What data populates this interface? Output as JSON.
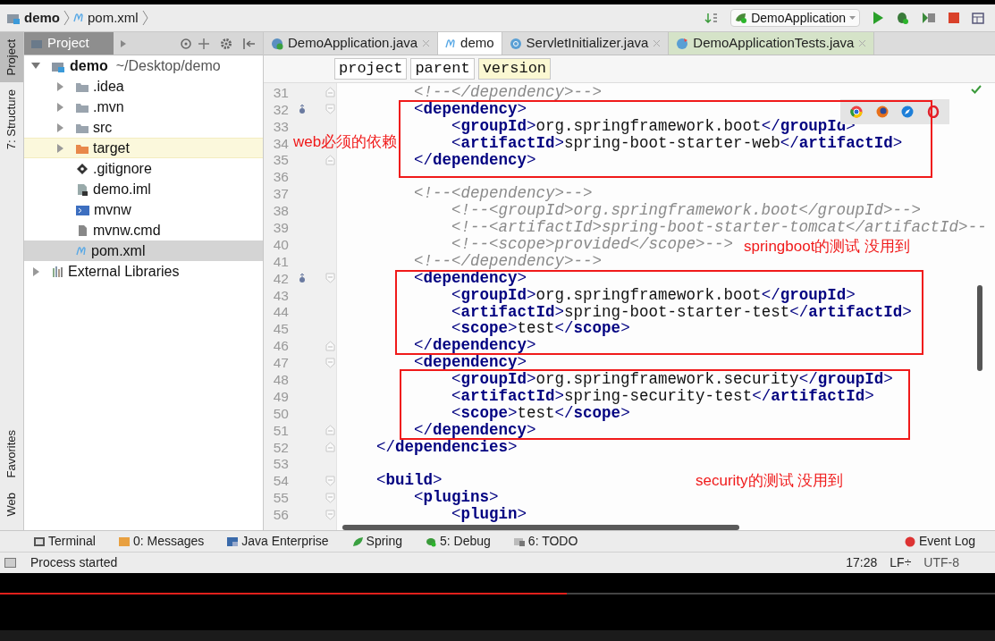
{
  "navigation_bar": {
    "breadcrumbs": [
      {
        "label": "demo",
        "kind": "module"
      },
      {
        "label": "pom.xml",
        "kind": "maven"
      }
    ],
    "run_configuration": "DemoApplication"
  },
  "tool_strip": {
    "left_top": [
      {
        "label": "Project",
        "selected": true
      },
      {
        "label": "7: Structure",
        "selected": false
      }
    ],
    "left_bottom": [
      {
        "label": "Favorites",
        "selected": false
      },
      {
        "label": "Web",
        "selected": false
      }
    ]
  },
  "project_panel": {
    "title": "Project",
    "tree": [
      {
        "label": "demo",
        "path": "~/Desktop/demo",
        "kind": "module",
        "expanded": true,
        "selected": false,
        "highlighted": false,
        "children": [
          {
            "label": ".idea",
            "kind": "folder",
            "expanded": false,
            "selected": false,
            "highlighted": false
          },
          {
            "label": ".mvn",
            "kind": "folder",
            "expanded": false,
            "selected": false,
            "highlighted": false
          },
          {
            "label": "src",
            "kind": "folder",
            "expanded": false,
            "selected": false,
            "highlighted": false
          },
          {
            "label": "target",
            "kind": "excluded-folder",
            "expanded": false,
            "selected": false,
            "highlighted": true
          },
          {
            "label": ".gitignore",
            "kind": "git",
            "selected": false,
            "highlighted": false
          },
          {
            "label": "demo.iml",
            "kind": "iml",
            "selected": false,
            "highlighted": false
          },
          {
            "label": "mvnw",
            "kind": "script",
            "selected": false,
            "highlighted": false
          },
          {
            "label": "mvnw.cmd",
            "kind": "file",
            "selected": false,
            "highlighted": false
          },
          {
            "label": "pom.xml",
            "kind": "maven",
            "selected": true,
            "highlighted": false
          }
        ]
      },
      {
        "label": "External Libraries",
        "kind": "library",
        "expanded": false,
        "selected": false,
        "highlighted": false
      }
    ]
  },
  "editor": {
    "tabs": [
      {
        "label": "DemoApplication.java",
        "kind": "spring",
        "selected": false
      },
      {
        "label": "demo",
        "kind": "maven",
        "selected": true
      },
      {
        "label": "ServletInitializer.java",
        "kind": "class",
        "selected": false
      },
      {
        "label": "DemoApplicationTests.java",
        "kind": "test",
        "selected": false
      }
    ],
    "tag_path": [
      {
        "label": "project",
        "selected": false
      },
      {
        "label": "parent",
        "selected": false
      },
      {
        "label": "version",
        "selected": true
      }
    ],
    "lines": [
      {
        "number": "31",
        "kind": "comment",
        "text": "        <!--</dependency>-->",
        "fold_close": true
      },
      {
        "number": "32",
        "kind": "code",
        "text": "        <dependency>",
        "fold_open": true,
        "overridden": true
      },
      {
        "number": "33",
        "kind": "code",
        "text": "            <groupId>org.springframework.boot</groupId>"
      },
      {
        "number": "34",
        "kind": "code",
        "text": "            <artifactId>spring-boot-starter-web</artifactId>"
      },
      {
        "number": "35",
        "kind": "code",
        "text": "        </dependency>",
        "fold_close": true
      },
      {
        "number": "36",
        "kind": "blank"
      },
      {
        "number": "37",
        "kind": "comment",
        "text": "        <!--<dependency>-->"
      },
      {
        "number": "38",
        "kind": "comment",
        "text": "            <!--<groupId>org.springframework.boot</groupId>-->"
      },
      {
        "number": "39",
        "kind": "comment",
        "text": "            <!--<artifactId>spring-boot-starter-tomcat</artifactId>--"
      },
      {
        "number": "40",
        "kind": "comment",
        "text": "            <!--<scope>provided</scope>-->"
      },
      {
        "number": "41",
        "kind": "comment",
        "text": "        <!--</dependency>-->"
      },
      {
        "number": "42",
        "kind": "code",
        "text": "        <dependency>",
        "fold_open": true,
        "overridden": true
      },
      {
        "number": "43",
        "kind": "code",
        "text": "            <groupId>org.springframework.boot</groupId>"
      },
      {
        "number": "44",
        "kind": "code",
        "text": "            <artifactId>spring-boot-starter-test</artifactId>"
      },
      {
        "number": "45",
        "kind": "code",
        "text": "            <scope>test</scope>"
      },
      {
        "number": "46",
        "kind": "code",
        "text": "        </dependency>",
        "fold_close": true
      },
      {
        "number": "47",
        "kind": "code",
        "text": "        <dependency>",
        "fold_open": true
      },
      {
        "number": "48",
        "kind": "code",
        "text": "            <groupId>org.springframework.security</groupId>"
      },
      {
        "number": "49",
        "kind": "code",
        "text": "            <artifactId>spring-security-test</artifactId>"
      },
      {
        "number": "50",
        "kind": "code",
        "text": "            <scope>test</scope>"
      },
      {
        "number": "51",
        "kind": "code",
        "text": "        </dependency>",
        "fold_close": true
      },
      {
        "number": "52",
        "kind": "code",
        "text": "    </dependencies>",
        "fold_close": true
      },
      {
        "number": "53",
        "kind": "blank"
      },
      {
        "number": "54",
        "kind": "code",
        "text": "    <build>",
        "fold_open": true
      },
      {
        "number": "55",
        "kind": "code",
        "text": "        <plugins>",
        "fold_open": true
      },
      {
        "number": "56",
        "kind": "code",
        "text": "            <plugin>",
        "fold_open": true
      }
    ],
    "annotations": [
      {
        "text": "web必须的依赖"
      },
      {
        "text": "springboot的测试 没用到"
      },
      {
        "text": "security的测试 没用到"
      }
    ]
  },
  "tool_windows": [
    {
      "label": "Terminal",
      "kind": "terminal"
    },
    {
      "label": "0: Messages",
      "kind": "messages"
    },
    {
      "label": "Java Enterprise",
      "kind": "enterprise"
    },
    {
      "label": "Spring",
      "kind": "spring"
    },
    {
      "label": "5: Debug",
      "kind": "debug"
    },
    {
      "label": "6: TODO",
      "kind": "todo"
    }
  ],
  "event_log": "Event Log",
  "status_bar": {
    "message": "Process started",
    "position": "17:28",
    "line_separator": "LF÷",
    "encoding": "UTF-8"
  },
  "video_player": {
    "progress": {
      "level": 0.57
    }
  }
}
